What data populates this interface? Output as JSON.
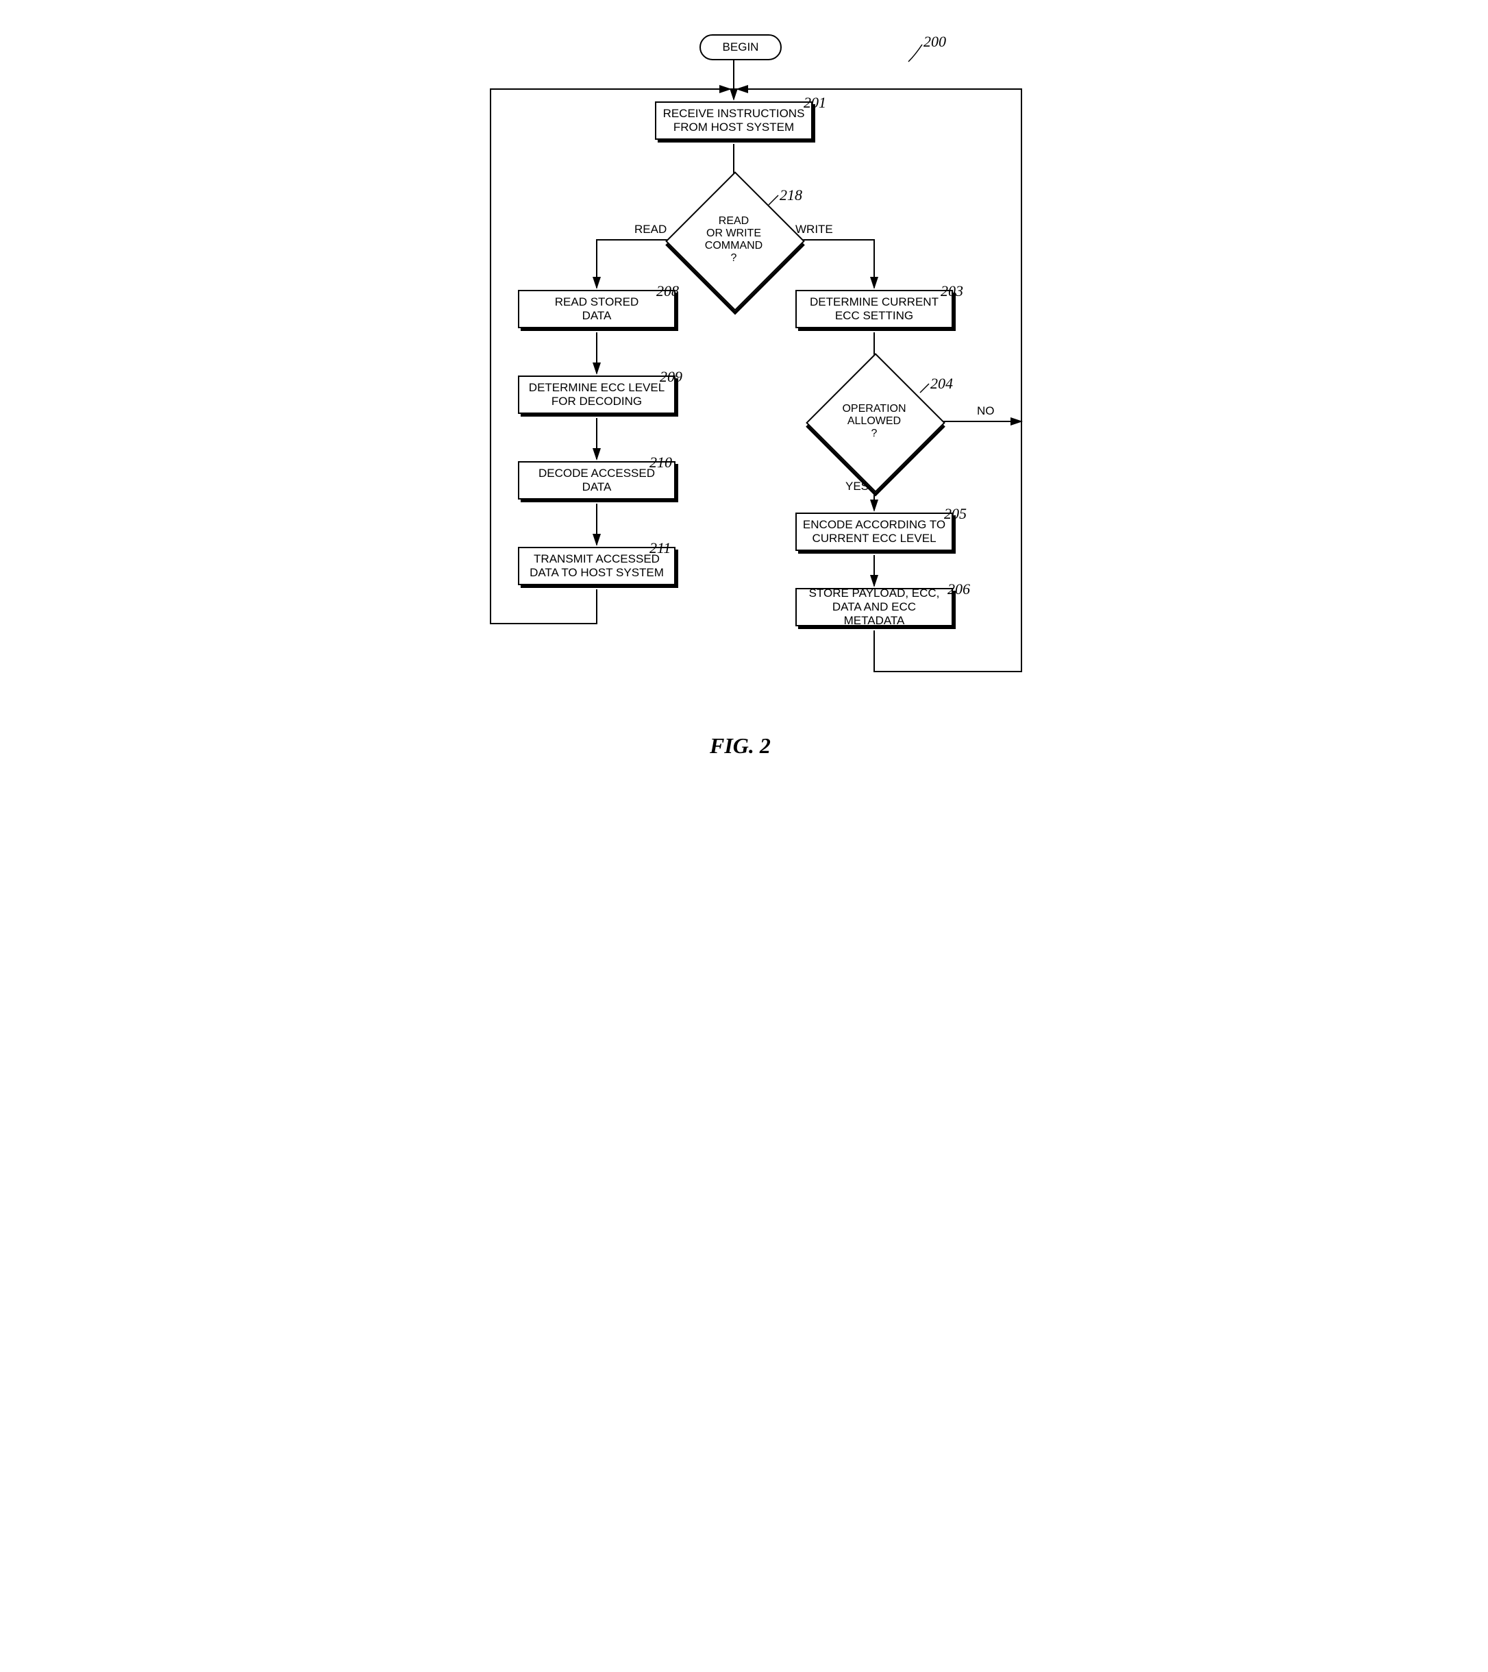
{
  "figure_label": "FIG. 2",
  "title_callout": "200",
  "begin": "BEGIN",
  "step201": {
    "text": "RECEIVE INSTRUCTIONS\nFROM HOST SYSTEM",
    "num": "201"
  },
  "decision218": {
    "text": "READ\nOR WRITE\nCOMMAND\n?",
    "num": "218",
    "left": "READ",
    "right": "WRITE"
  },
  "step208": {
    "text": "READ STORED\nDATA",
    "num": "208"
  },
  "step209": {
    "text": "DETERMINE ECC LEVEL\nFOR DECODING",
    "num": "209"
  },
  "step210": {
    "text": "DECODE ACCESSED DATA",
    "num": "210"
  },
  "step211": {
    "text": "TRANSMIT ACCESSED\nDATA TO HOST SYSTEM",
    "num": "211"
  },
  "step203": {
    "text": "DETERMINE CURRENT\nECC SETTING",
    "num": "203"
  },
  "decision204": {
    "text": "OPERATION\nALLOWED\n?",
    "num": "204",
    "yes": "YES",
    "no": "NO"
  },
  "step205": {
    "text": "ENCODE ACCORDING TO\nCURRENT ECC LEVEL",
    "num": "205"
  },
  "step206": {
    "text": "STORE PAYLOAD, ECC,\nDATA AND ECC METADATA",
    "num": "206"
  }
}
